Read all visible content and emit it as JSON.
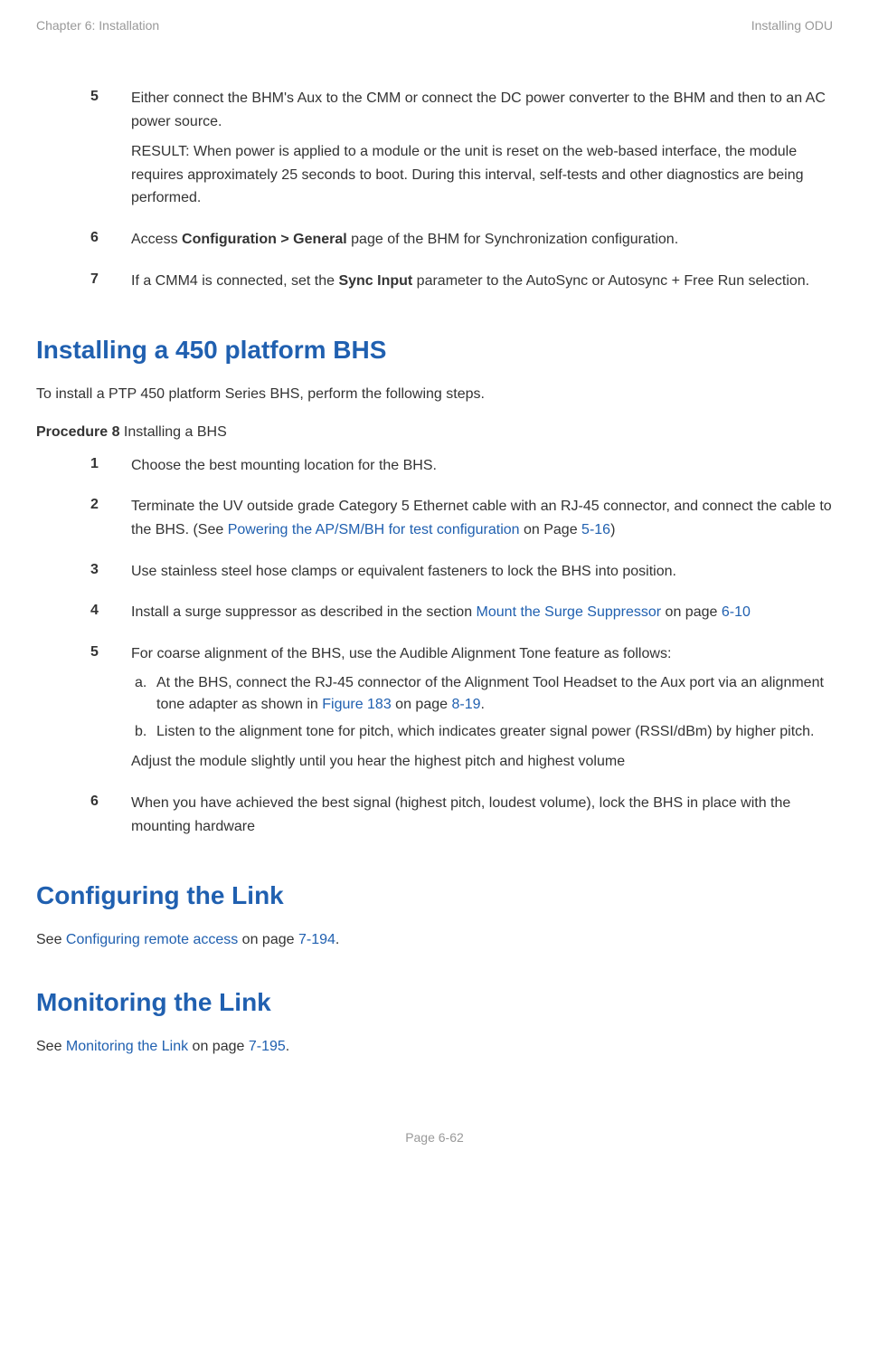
{
  "header": {
    "left": "Chapter 6:  Installation",
    "right": "Installing ODU"
  },
  "topList": {
    "item5": {
      "num": "5",
      "p1_a": "Either connect the BHM's Aux to the CMM or connect the DC power converter to the BHM and then to an AC power source.",
      "p2_a": "RESULT: When power is applied to a module or the unit is reset on the web-based interface, the module requires approximately 25 seconds to boot. During this interval, self-tests and other diagnostics are being performed."
    },
    "item6": {
      "num": "6",
      "t1": "Access ",
      "b1": "Configuration > General",
      "t2": " page of the BHM for Synchronization configuration."
    },
    "item7": {
      "num": "7",
      "t1": "If a CMM4 is connected, set the ",
      "b1": "Sync Input",
      "t2": " parameter to the AutoSync or Autosync + Free Run selection."
    }
  },
  "section1": {
    "heading": "Installing a 450 platform BHS",
    "intro": "To install a PTP 450 platform Series BHS, perform the following steps.",
    "procLabelBold": "Procedure 8",
    "procLabelRest": " Installing a BHS",
    "item1": {
      "num": "1",
      "text": "Choose the best mounting location for the BHS."
    },
    "item2": {
      "num": "2",
      "t1": "Terminate the UV outside grade Category 5 Ethernet cable with an RJ-45 connector, and connect the cable to the BHS. (See ",
      "link1": "Powering the AP/SM/BH for test configuration",
      "t2": " on Page ",
      "link2": "5-16",
      "t3": ")"
    },
    "item3": {
      "num": "3",
      "text": "Use stainless steel hose clamps or equivalent fasteners to lock the BHS into position."
    },
    "item4": {
      "num": "4",
      "t1": "Install a surge suppressor as described in the section ",
      "link1": "Mount the Surge Suppressor",
      "t2": " on page ",
      "link2": "6-10"
    },
    "item5": {
      "num": "5",
      "intro": "For coarse alignment of the BHS, use the Audible Alignment Tone feature as follows:",
      "a": {
        "letter": "a.",
        "t1": "At the BHS, connect the RJ-45 connector of the Alignment Tool Headset to the Aux port via an alignment tone adapter as shown in ",
        "link1": "Figure 183",
        "t2": " on page ",
        "link2": "8-19",
        "t3": "."
      },
      "b": {
        "letter": "b.",
        "text": "Listen to the alignment tone for pitch, which indicates greater signal power (RSSI/dBm) by higher pitch."
      },
      "adjust": "Adjust the module slightly until you hear the highest pitch and highest volume"
    },
    "item6": {
      "num": "6",
      "text": "When you have achieved the best signal (highest pitch, loudest volume), lock the BHS in place with the mounting hardware"
    }
  },
  "section2": {
    "heading": "Configuring the Link",
    "t1": "See ",
    "link1": "Configuring remote access",
    "t2": " on page ",
    "link2": "7-194",
    "t3": "."
  },
  "section3": {
    "heading": "Monitoring the Link",
    "t1": "See ",
    "link1": "Monitoring the Link",
    "t2": " on page ",
    "link2": "7-195",
    "t3": "."
  },
  "footer": {
    "text": "Page 6-62"
  }
}
